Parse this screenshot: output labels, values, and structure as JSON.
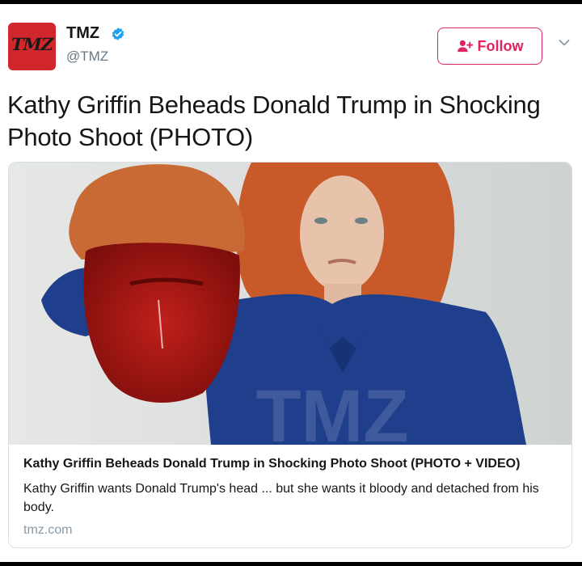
{
  "account": {
    "logo_text": "TMZ",
    "display_name": "TMZ",
    "handle": "@TMZ",
    "verified": true,
    "avatar_color": "#d1262c"
  },
  "follow_button": {
    "label": "Follow",
    "icon": "add-user-icon",
    "color": "#e0245e"
  },
  "menu": {
    "icon": "chevron-down-icon"
  },
  "tweet": {
    "text": "Kathy Griffin Beheads Donald Trump in Shocking Photo Shoot (PHOTO)"
  },
  "card": {
    "image_watermark": "TMZ",
    "title": "Kathy Griffin Beheads Donald Trump in Shocking Photo Shoot (PHOTO + VIDEO)",
    "description": "Kathy Griffin wants Donald Trump's head ... but she wants it bloody and detached from his body.",
    "domain": "tmz.com"
  }
}
